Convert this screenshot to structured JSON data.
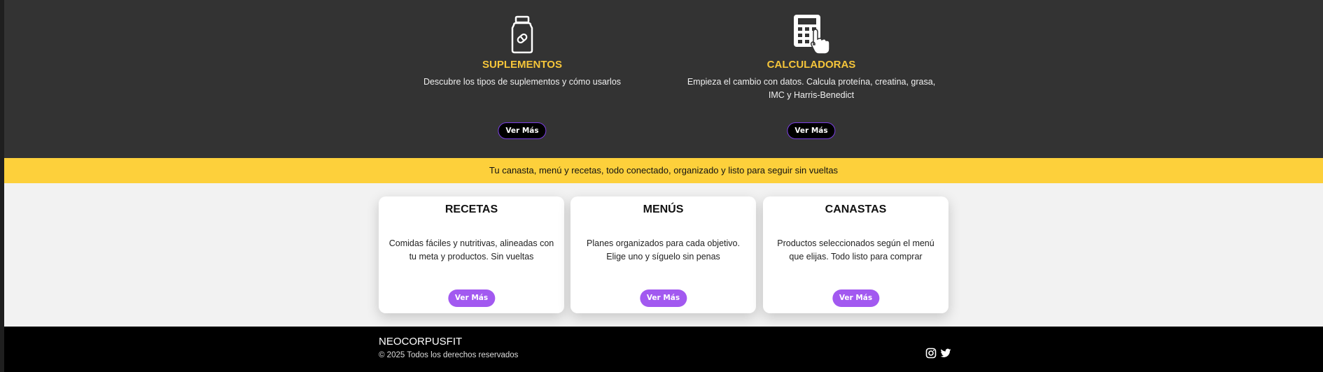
{
  "features": [
    {
      "title": "SUPLEMENTOS",
      "description": "Descubre los tipos de suplementos y cómo usarlos",
      "button": "Ver Más",
      "icon": "supplement-jar-icon"
    },
    {
      "title": "CALCULADORAS",
      "description": "Empieza el cambio con datos. Calcula proteína, creatina, grasa, IMC y Harris-Benedict",
      "button": "Ver Más",
      "icon": "calculator-hand-icon"
    }
  ],
  "banner": {
    "text": "Tu canasta, menú y recetas, todo conectado, organizado y listo para seguir sin vueltas"
  },
  "cards": [
    {
      "title": "RECETAS",
      "description": "Comidas fáciles y nutritivas, alineadas con tu meta y productos. Sin vueltas",
      "button": "Ver Más"
    },
    {
      "title": "MENÚS",
      "description": "Planes organizados para cada objetivo. Elige uno y síguelo sin penas",
      "button": "Ver Más"
    },
    {
      "title": "CANASTAS",
      "description": "Productos seleccionados según el menú que elijas. Todo listo para comprar",
      "button": "Ver Más"
    }
  ],
  "footer": {
    "brand": "NEOCORPUSFIT",
    "copyright": "© 2025 Todos los derechos reservados",
    "social": [
      "instagram-icon",
      "twitter-icon"
    ]
  },
  "colors": {
    "dark_bg": "#333333",
    "accent_yellow": "#f5c53a",
    "banner_yellow": "#fdd03b",
    "button_purple": "#a259f0",
    "footer_bg": "#000000"
  }
}
